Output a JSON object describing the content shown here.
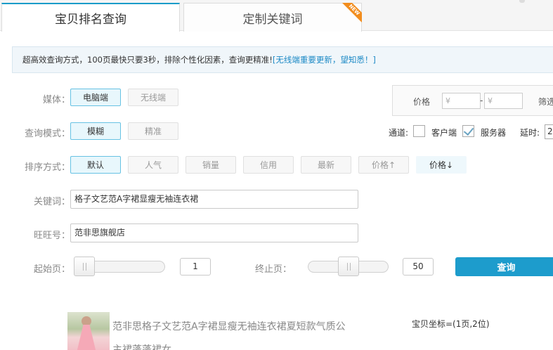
{
  "tabs": [
    {
      "label": "宝贝排名查询",
      "active": true
    },
    {
      "label": "定制关键词",
      "badge": "NEW"
    }
  ],
  "notice": {
    "text": "超高效查询方式，100页最快只要3秒，排除个性化因素，查询更精准!",
    "link": "[无线端重要更新，望知悉！]"
  },
  "media": {
    "label": "媒体：",
    "options": [
      "电脑端",
      "无线端"
    ],
    "selected": "电脑端"
  },
  "mode": {
    "label": "查询模式：",
    "options": [
      "模糊",
      "精准"
    ],
    "selected": "模糊"
  },
  "sort": {
    "label": "排序方式：",
    "options": [
      "默认",
      "人气",
      "销量",
      "信用",
      "最新",
      "价格↑",
      "价格↓"
    ],
    "selected": "默认"
  },
  "price": {
    "label": "价格",
    "min_placeholder": "¥",
    "max_placeholder": "¥",
    "dash": "-",
    "filter_label": "筛选"
  },
  "channel": {
    "label": "通道:",
    "client_label": "客户端",
    "client_checked": false,
    "server_label": "服务器",
    "server_checked": true,
    "delay_label": "延时:",
    "delay_value": "2"
  },
  "keyword": {
    "label": "关键词：",
    "value": "格子文艺范A字裙显瘦无袖连衣裙"
  },
  "wangwang": {
    "label": "旺旺号：",
    "value": "范非思旗舰店"
  },
  "start_page": {
    "label": "起始页：",
    "value": "1",
    "slider_fraction": 0.0
  },
  "end_page": {
    "label": "终止页：",
    "value": "50",
    "slider_fraction": 0.5
  },
  "search_button": "查询",
  "result": {
    "title": "范非思格子文艺范A字裙显瘦无袖连衣裙夏短款气质公主裙蓬蓬裙女",
    "coord": "宝贝坐标=(1页,2位)"
  }
}
